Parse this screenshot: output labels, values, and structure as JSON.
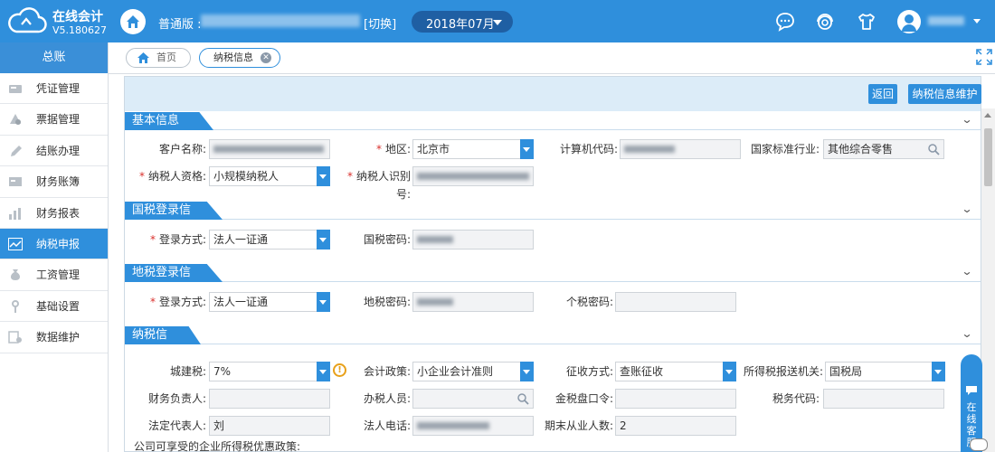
{
  "app": {
    "name": "在线会计",
    "version": "V5.180627"
  },
  "header": {
    "edition_label": "普通版 :",
    "switch_label": "[切换]",
    "period": "2018年07月"
  },
  "sidebar": {
    "title": "总账",
    "items": [
      {
        "label": "凭证管理",
        "icon": "voucher-icon"
      },
      {
        "label": "票据管理",
        "icon": "invoice-icon"
      },
      {
        "label": "结账办理",
        "icon": "pen-icon"
      },
      {
        "label": "财务账簿",
        "icon": "ledger-icon"
      },
      {
        "label": "财务报表",
        "icon": "bar-chart-icon"
      },
      {
        "label": "纳税申报",
        "icon": "trend-icon",
        "active": true
      },
      {
        "label": "工资管理",
        "icon": "money-bag-icon"
      },
      {
        "label": "基础设置",
        "icon": "settings-icon"
      },
      {
        "label": "数据维护",
        "icon": "database-icon"
      }
    ]
  },
  "tabs": {
    "home": "首页",
    "current": "纳税信息",
    "close": "✕"
  },
  "actions": {
    "back": "返回",
    "maintain": "纳税信息维护"
  },
  "sections": {
    "basic": {
      "title": "基本信息",
      "client_name_label": "客户名称:",
      "region_label": "地区:",
      "region_value": "北京市",
      "computer_code_label": "计算机代码:",
      "industry_label": "国家标准行业:",
      "industry_value": "其他综合零售",
      "taxpayer_type_label": "纳税人资格:",
      "taxpayer_type_value": "小规模纳税人",
      "taxpayer_id_label": "纳税人识别号:"
    },
    "national": {
      "title": "国税登录信息",
      "login_label": "登录方式:",
      "login_value": "法人一证通",
      "password_label": "国税密码:"
    },
    "local": {
      "title": "地税登录信息",
      "login_label": "登录方式:",
      "login_value": "法人一证通",
      "password_label": "地税密码:",
      "personal_password_label": "个税密码:"
    },
    "tax": {
      "title": "纳税信息",
      "urban_tax_label": "城建税:",
      "urban_tax_value": "7%",
      "warning_glyph": "!",
      "accounting_policy_label": "会计政策:",
      "accounting_policy_value": "小企业会计准则",
      "collection_label": "征收方式:",
      "collection_value": "查账征收",
      "authority_label": "所得税报送机关:",
      "authority_value": "国税局",
      "finance_head_label": "财务负责人:",
      "handler_label": "办税人员:",
      "disk_pwd_label": "金税盘口令:",
      "tax_agent_label": "税务代码:",
      "legal_rep_label": "法定代表人:",
      "legal_rep_value": "刘",
      "legal_phone_label": "法人电话:",
      "employees_label": "期末从业人数:",
      "employees_value": "2",
      "cut_line": "公司可享受的企业所得税优惠政策:"
    }
  },
  "online_service": "在线客服",
  "colors": {
    "primary": "#2f8fdc",
    "header": "#2f8fdc",
    "required": "#d9302c",
    "warning": "#e8a11b"
  }
}
